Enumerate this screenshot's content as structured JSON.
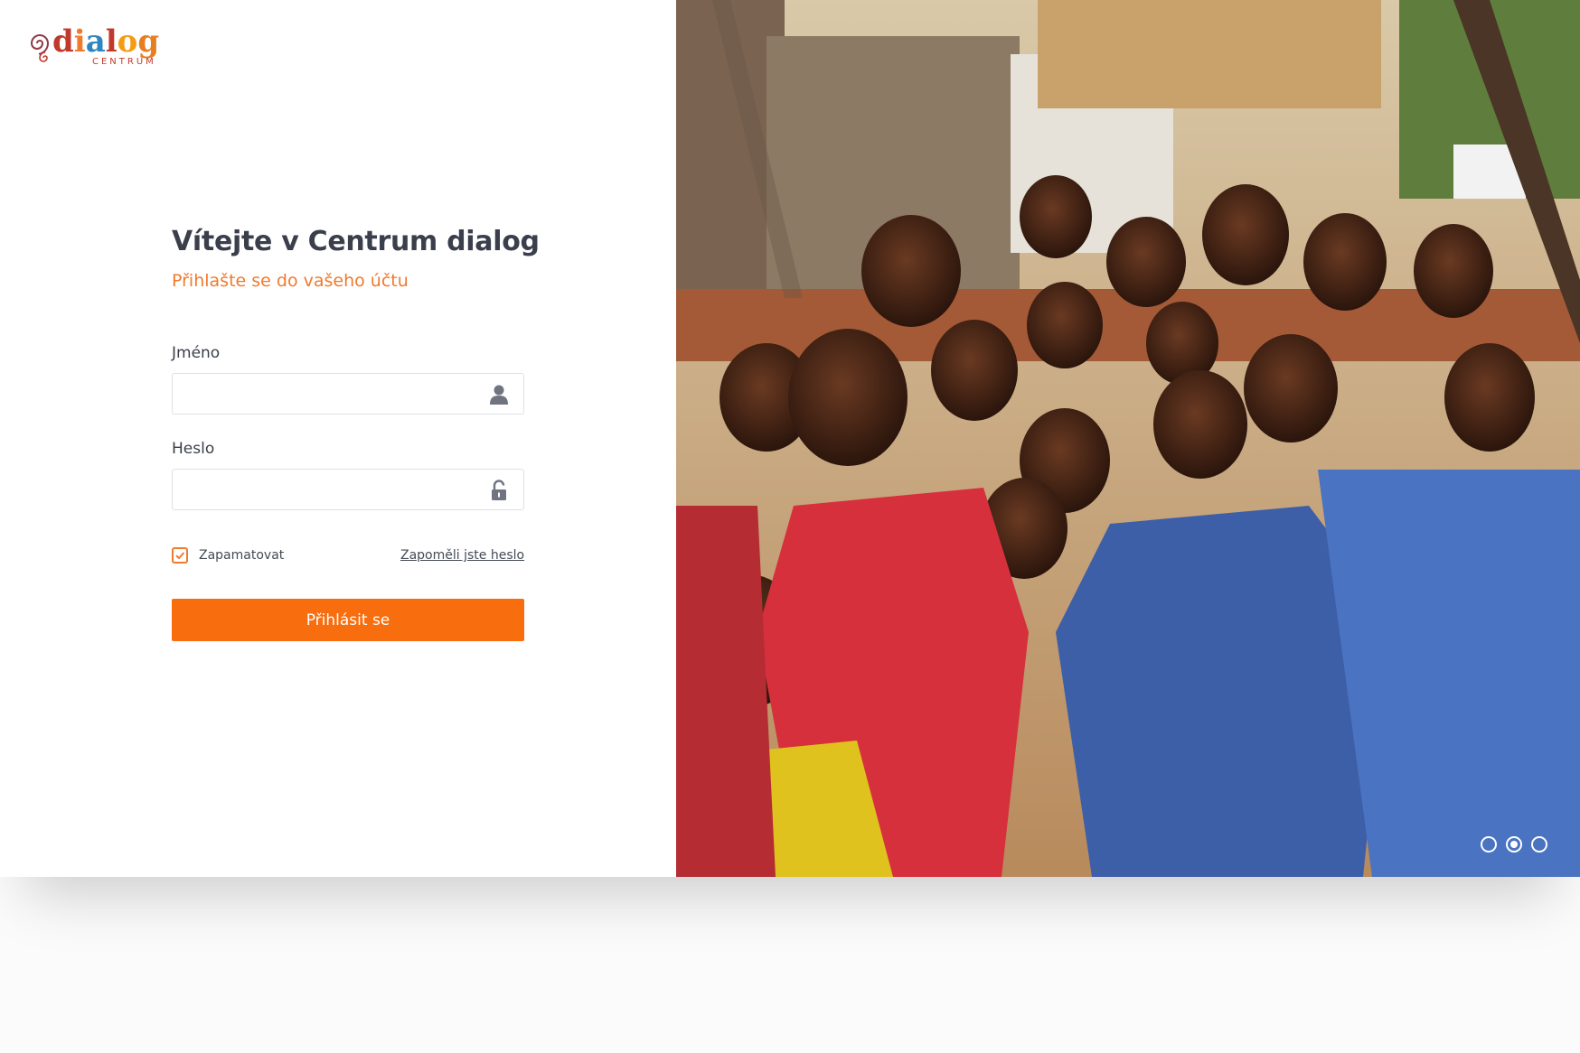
{
  "brand": {
    "name": "dialog",
    "subtitle": "CENTRUM",
    "letters": [
      {
        "ch": "d",
        "color": "#c0392b"
      },
      {
        "ch": "i",
        "color": "#f07a2d"
      },
      {
        "ch": "a",
        "color": "#2e86c1"
      },
      {
        "ch": "l",
        "color": "#c0392b"
      },
      {
        "ch": "o",
        "color": "#f39c12"
      },
      {
        "ch": "g",
        "color": "#e67e22"
      }
    ]
  },
  "login": {
    "title": "Vítejte v Centrum dialog",
    "subtitle": "Přihlašte se do vašeho účtu",
    "username_label": "Jméno",
    "username_value": "",
    "username_icon": "user-icon",
    "password_label": "Heslo",
    "password_value": "",
    "password_icon": "unlock-icon",
    "remember_label": "Zapamatovat",
    "remember_checked": true,
    "forgot_link": "Zapoměli jste heslo",
    "submit_label": "Přihlásit se"
  },
  "colors": {
    "accent": "#f86d0e",
    "title": "#3a3f4b",
    "subtitle": "#f07a2d"
  },
  "carousel": {
    "slides": 3,
    "active_index": 1
  }
}
